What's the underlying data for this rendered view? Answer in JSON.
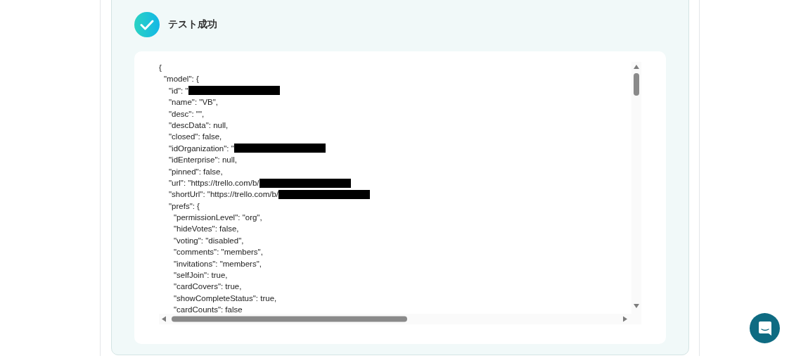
{
  "result": {
    "title": "テスト成功",
    "passed": true,
    "code": [
      {
        "text": "{",
        "children": [
          {
            "text": "\"model\": {",
            "children": [
              {
                "text": "\"id\": \"",
                "redacted": true
              },
              {
                "text": "\"name\": \"VB\","
              },
              {
                "text": "\"desc\": \"\","
              },
              {
                "text": "\"descData\": null,"
              },
              {
                "text": "\"closed\": false,"
              },
              {
                "text": "\"idOrganization\": \"",
                "redacted": true
              },
              {
                "text": "\"idEnterprise\": null,"
              },
              {
                "text": "\"pinned\": false,"
              },
              {
                "text": "\"url\": \"https://trello.com/b/",
                "redacted": true
              },
              {
                "text": "\"shortUrl\": \"https://trello.com/b/",
                "redacted": true
              },
              {
                "text": "\"prefs\": {",
                "children": [
                  {
                    "text": "\"permissionLevel\": \"org\","
                  },
                  {
                    "text": "\"hideVotes\": false,"
                  },
                  {
                    "text": "\"voting\": \"disabled\","
                  },
                  {
                    "text": "\"comments\": \"members\","
                  },
                  {
                    "text": "\"invitations\": \"members\","
                  },
                  {
                    "text": "\"selfJoin\": true,"
                  },
                  {
                    "text": "\"cardCovers\": true,"
                  },
                  {
                    "text": "\"showCompleteStatus\": true,"
                  },
                  {
                    "text": "\"cardCounts\": false"
                  }
                ]
              }
            ]
          }
        ]
      }
    ]
  }
}
